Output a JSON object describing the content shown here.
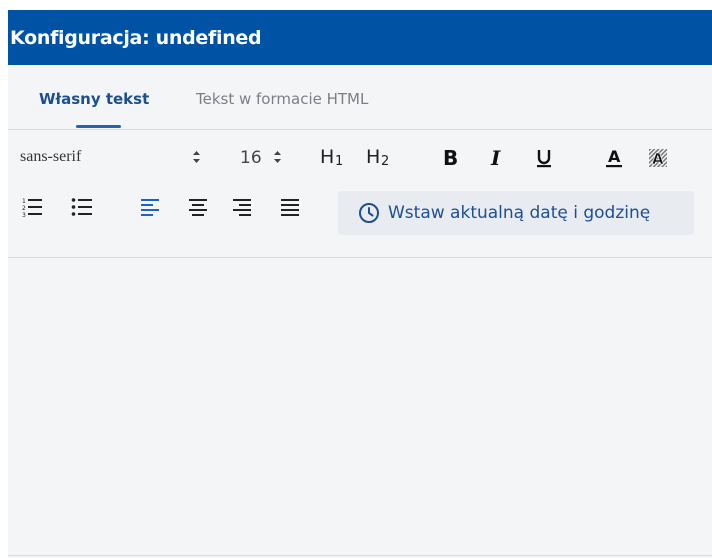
{
  "window": {
    "title": "Konfiguracja: undefined"
  },
  "tabs": [
    {
      "label": "Własny tekst",
      "active": true
    },
    {
      "label": "Tekst w formacie HTML",
      "active": false
    }
  ],
  "toolbar": {
    "font_family": "sans-serif",
    "font_size": "16",
    "h1_label": "H1",
    "h2_label": "H2",
    "insert_date_label": "Wstaw aktualną datę i godzinę",
    "icons": {
      "bold": "bold-icon",
      "italic": "italic-icon",
      "underline": "underline-icon",
      "text_color": "text-color-icon",
      "bg_color": "background-color-icon",
      "ordered_list": "ordered-list-icon",
      "bullet_list": "bullet-list-icon",
      "align_left": "align-left-icon",
      "align_center": "align-center-icon",
      "align_right": "align-right-icon",
      "align_justify": "align-justify-icon",
      "clock": "clock-icon"
    },
    "active_alignment": "left"
  },
  "colors": {
    "titlebar": "#0052a5",
    "accent": "#1d63c4",
    "active_tab_text": "#1d4f91",
    "panel_bg": "#f4f5f7"
  }
}
